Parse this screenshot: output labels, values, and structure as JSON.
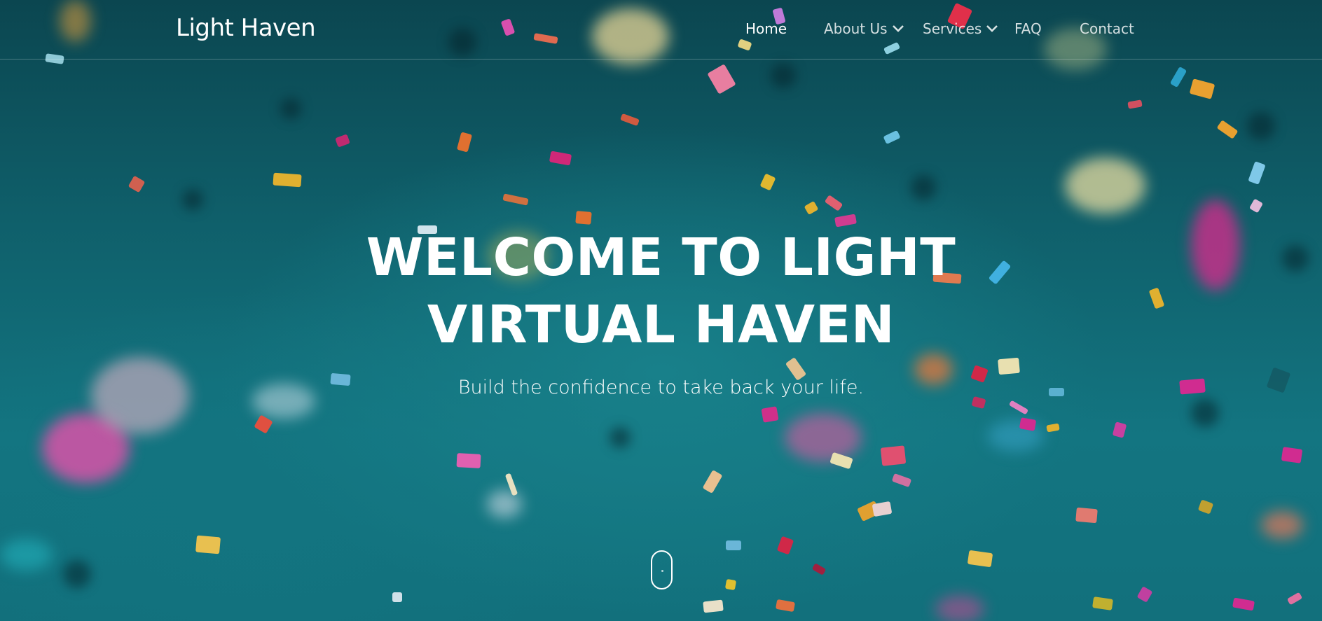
{
  "brand": {
    "name": "Light Haven"
  },
  "nav": {
    "items": [
      {
        "label": "Home",
        "active": true,
        "dropdown": false
      },
      {
        "label": "About Us",
        "active": false,
        "dropdown": true,
        "icon": "chevron-down-icon"
      },
      {
        "label": "Services",
        "active": false,
        "dropdown": true,
        "icon": "chevron-down-icon"
      },
      {
        "label": "FAQ",
        "active": false,
        "dropdown": false
      },
      {
        "label": "Contact",
        "active": false,
        "dropdown": false
      }
    ]
  },
  "hero": {
    "title_line1": "WELCOME TO LIGHT",
    "title_line2": "VIRTUAL HAVEN",
    "subtitle": "Build the confidence to take back your life.",
    "scroll_icon": "mouse-scroll-icon",
    "background_color": "#0f5f6a"
  },
  "colors": {
    "text": "#ffffff",
    "background": "#0f5f6a"
  }
}
